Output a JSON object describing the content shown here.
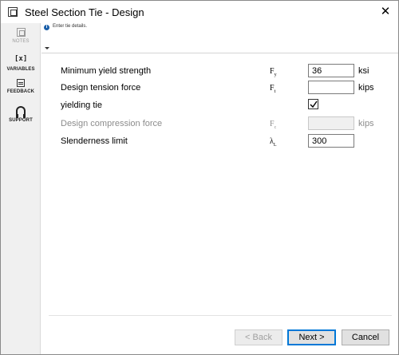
{
  "window": {
    "title": "Steel Section Tie - Design",
    "close_label": "✕"
  },
  "sidebar": {
    "items": [
      {
        "label": "NOTES",
        "icon": "notes-icon",
        "enabled": false
      },
      {
        "label": "VARIABLES",
        "icon": "variables-icon",
        "glyph": "[x]",
        "enabled": true
      },
      {
        "label": "FEEDBACK",
        "icon": "feedback-icon",
        "enabled": true
      },
      {
        "label": "SUPPORT",
        "icon": "headset-icon",
        "enabled": true
      }
    ]
  },
  "info": {
    "text": "Enter tie details.",
    "icon_glyph": "i"
  },
  "form": {
    "rows": [
      {
        "label": "Minimum yield strength",
        "symbol": "F",
        "symbol_sub": "y",
        "value": "36",
        "unit": "ksi",
        "enabled": true
      },
      {
        "label": "Design tension force",
        "symbol": "F",
        "symbol_sub": "t",
        "value": "",
        "unit": "kips",
        "enabled": true
      },
      {
        "label": "yielding tie",
        "checked": true,
        "enabled": true
      },
      {
        "label": "Design compression force",
        "symbol": "F",
        "symbol_sub": "c",
        "value": "",
        "unit": "kips",
        "enabled": false
      },
      {
        "label": "Slenderness limit",
        "symbol": "λ",
        "symbol_sub": "L",
        "value": "300",
        "unit": "",
        "enabled": true
      }
    ]
  },
  "footer": {
    "back_label": "< Back",
    "next_label": "Next >",
    "cancel_label": "Cancel"
  },
  "colors": {
    "accent": "#0078d7",
    "info_icon": "#1a5ea8",
    "disabled_text": "#8c8c8c"
  }
}
